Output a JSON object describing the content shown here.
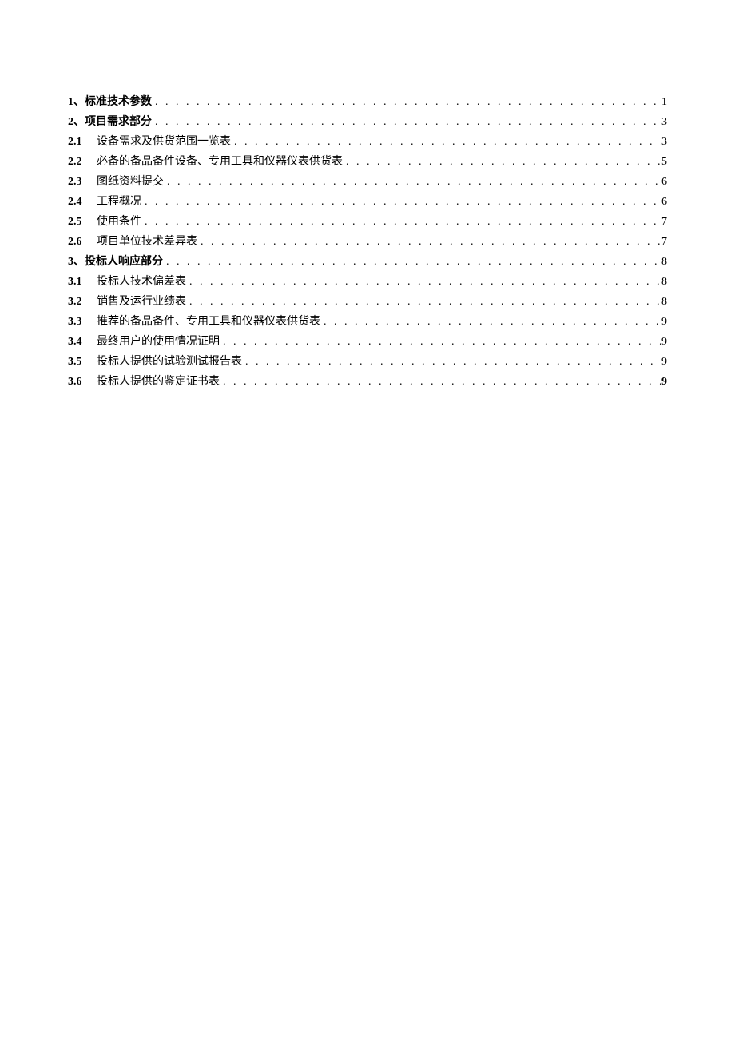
{
  "toc": [
    {
      "num": "1、",
      "title": "标准技术参数",
      "page": "1",
      "main": true,
      "sub": false,
      "boldPage": false
    },
    {
      "num": "2、",
      "title": "项目需求部分",
      "page": "3",
      "main": true,
      "sub": false,
      "boldPage": false
    },
    {
      "num": "2.1",
      "title": "设备需求及供货范围一览表",
      "page": "3",
      "main": false,
      "sub": true,
      "boldPage": false
    },
    {
      "num": "2.2",
      "title": "必备的备品备件设备、专用工具和仪器仪表供货表",
      "page": "5",
      "main": false,
      "sub": true,
      "boldPage": false
    },
    {
      "num": "2.3",
      "title": "图纸资料提交",
      "page": "6",
      "main": false,
      "sub": true,
      "boldPage": false
    },
    {
      "num": "2.4",
      "title": "工程概况",
      "page": "6",
      "main": false,
      "sub": true,
      "boldPage": false
    },
    {
      "num": "2.5",
      "title": "使用条件",
      "page": "7",
      "main": false,
      "sub": true,
      "boldPage": false
    },
    {
      "num": "2.6",
      "title": "项目单位技术差异表",
      "page": "7",
      "main": false,
      "sub": true,
      "boldPage": false
    },
    {
      "num": "3、",
      "title": "投标人响应部分",
      "page": "8",
      "main": true,
      "sub": false,
      "boldPage": false
    },
    {
      "num": "3.1",
      "title": "投标人技术偏差表",
      "page": "8",
      "main": false,
      "sub": true,
      "boldPage": false
    },
    {
      "num": "3.2",
      "title": "销售及运行业绩表",
      "page": "8",
      "main": false,
      "sub": true,
      "boldPage": false
    },
    {
      "num": "3.3",
      "title": "推荐的备品备件、专用工具和仪器仪表供货表",
      "page": "9",
      "main": false,
      "sub": true,
      "boldPage": false
    },
    {
      "num": "3.4",
      "title": "最终用户的使用情况证明",
      "page": "9",
      "main": false,
      "sub": true,
      "boldPage": false
    },
    {
      "num": "3.5",
      "title": "投标人提供的试验测试报告表",
      "page": "9",
      "main": false,
      "sub": true,
      "boldPage": false
    },
    {
      "num": "3.6",
      "title": "投标人提供的鉴定证书表",
      "page": "9",
      "main": false,
      "sub": true,
      "boldPage": true
    }
  ],
  "leader": ". . . . . . . . . . . . . . . . . . . . . . . . . . . . . . . . . . . . . . . . . . . . . . . . . . . . . . . . . . . . . . . . . . . . . . . . . . . . . . . . . . . . . . . . . . . . . . . . . . . . . . . . . . . . . . . . . . . . . . . . . . . . . . . ."
}
